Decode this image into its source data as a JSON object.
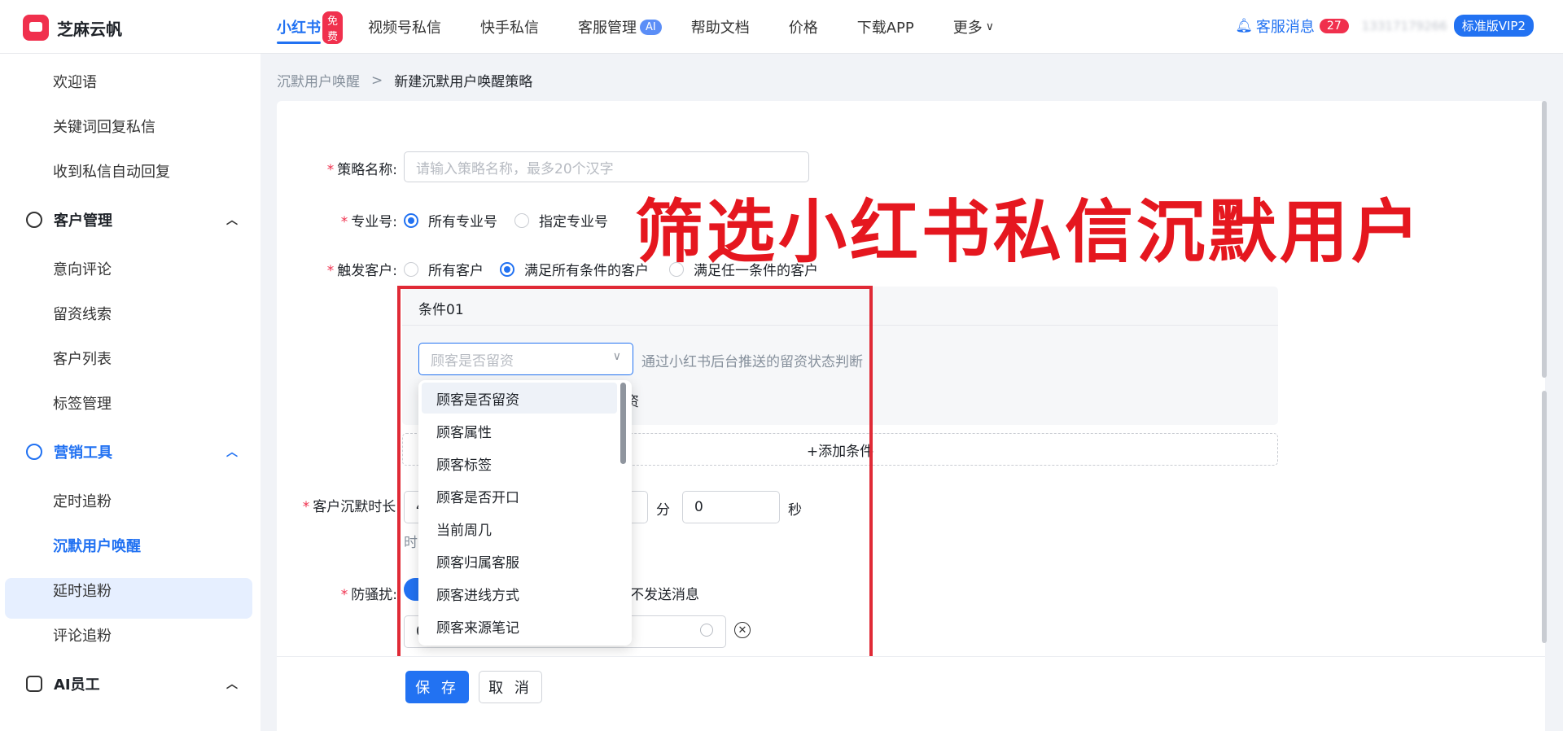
{
  "brand": {
    "name": "芝麻云帆"
  },
  "nav": {
    "items": [
      {
        "label": "小红书",
        "badge": "免费"
      },
      {
        "label": "视频号私信"
      },
      {
        "label": "快手私信"
      },
      {
        "label": "客服管理",
        "badge": "AI"
      },
      {
        "label": "帮助文档"
      },
      {
        "label": "价格"
      },
      {
        "label": "下载APP"
      },
      {
        "label": "更多",
        "icon": "chevron-down"
      }
    ]
  },
  "top_right": {
    "service_label": "客服消息",
    "service_count": "27",
    "phone": "13317179266",
    "plan": "标准版VIP2"
  },
  "sidebar": {
    "sub_top": [
      "欢迎语",
      "关键词回复私信",
      "收到私信自动回复"
    ],
    "group_customer": "客户管理",
    "sub_customer": [
      "意向评论",
      "留资线索",
      "客户列表",
      "标签管理"
    ],
    "group_marketing": "营销工具",
    "sub_marketing": [
      "定时追粉",
      "沉默用户唤醒",
      "延时追粉",
      "评论追粉"
    ],
    "group_ai": "AI员工"
  },
  "breadcrumb": {
    "parent": "沉默用户唤醒",
    "separator": ">",
    "current": "新建沉默用户唤醒策略"
  },
  "form": {
    "required_mark": "*",
    "name_label": "策略名称:",
    "name_placeholder": "请输入策略名称，最多20个汉字",
    "account_label": "专业号:",
    "account_options": [
      "所有专业号",
      "指定专业号"
    ],
    "account_selected": "所有专业号",
    "trigger_label": "触发客户:",
    "trigger_options": [
      "所有客户",
      "满足所有条件的客户",
      "满足任一条件的客户"
    ],
    "trigger_selected": "满足所有条件的客户",
    "condition_title": "条件01",
    "condition_select_placeholder": "顾客是否留资",
    "condition_hint": "通过小红书后台推送的留资状态判断",
    "condition_hint2": "资",
    "add_condition": "+添加条件",
    "silence_label": "客户沉默时长:",
    "silence_partial": "4",
    "unit_min": "分",
    "seconds_value": "0",
    "unit_sec": "秒",
    "silence_hint_partial": "时",
    "anti_label": "防骚扰:",
    "anti_toggle_partial": "开",
    "anti_text_partial": "不发送消息",
    "time_partial": "0",
    "save": "保 存",
    "cancel": "取 消"
  },
  "dropdown": {
    "options": [
      "顾客是否留资",
      "顾客属性",
      "顾客标签",
      "顾客是否开口",
      "当前周几",
      "顾客归属客服",
      "顾客进线方式",
      "顾客来源笔记"
    ],
    "highlighted": "顾客是否留资"
  },
  "overlay": {
    "caption": "筛选小红书私信沉默用户"
  },
  "colors": {
    "accent": "#2272f2",
    "brand": "#f0304d",
    "annotation": "#e02a36"
  }
}
